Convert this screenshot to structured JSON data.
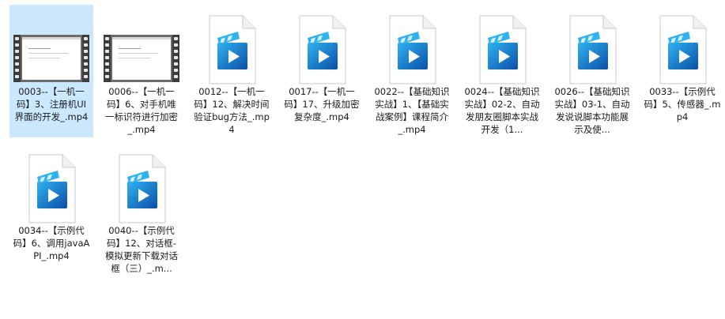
{
  "files": [
    {
      "label": "0003--【一机一码】3、注册机UI界面的开发_.mp4",
      "thumbnail": "video-frame",
      "selected": true
    },
    {
      "label": "0006--【一机一码】6、对手机唯一标识符进行加密_.mp4",
      "thumbnail": "video-frame",
      "selected": false
    },
    {
      "label": "0012--【一机一码】12、解决时间验证bug方法_.mp4",
      "thumbnail": "video-file-icon",
      "selected": false
    },
    {
      "label": "0017--【一机一码】17、升级加密复杂度_.mp4",
      "thumbnail": "video-file-icon",
      "selected": false
    },
    {
      "label": "0022--【基础知识实战】1、【基础实战案例】课程简介_.mp4",
      "thumbnail": "video-file-icon",
      "selected": false
    },
    {
      "label": "0024--【基础知识实战】02-2、自动发朋友圈脚本实战开发（1...",
      "thumbnail": "video-file-icon",
      "selected": false
    },
    {
      "label": "0026--【基础知识实战】03-1、自动发说说脚本功能展示及使...",
      "thumbnail": "video-file-icon",
      "selected": false
    },
    {
      "label": "0033--【示例代码】5、传感器_.mp4",
      "thumbnail": "video-file-icon",
      "selected": false
    },
    {
      "label": "0034--【示例代码】6、调用javaAPI_.mp4",
      "thumbnail": "video-file-icon",
      "selected": false
    },
    {
      "label": "0040--【示例代码】12、对话框-模拟更新下载对话框（三）_.m...",
      "thumbnail": "video-file-icon",
      "selected": false
    }
  ],
  "colors": {
    "selection": "#cce8ff",
    "icon_blue": "#1a73d9",
    "icon_dark": "#0b4fa8",
    "icon_light": "#2fb2f0"
  }
}
